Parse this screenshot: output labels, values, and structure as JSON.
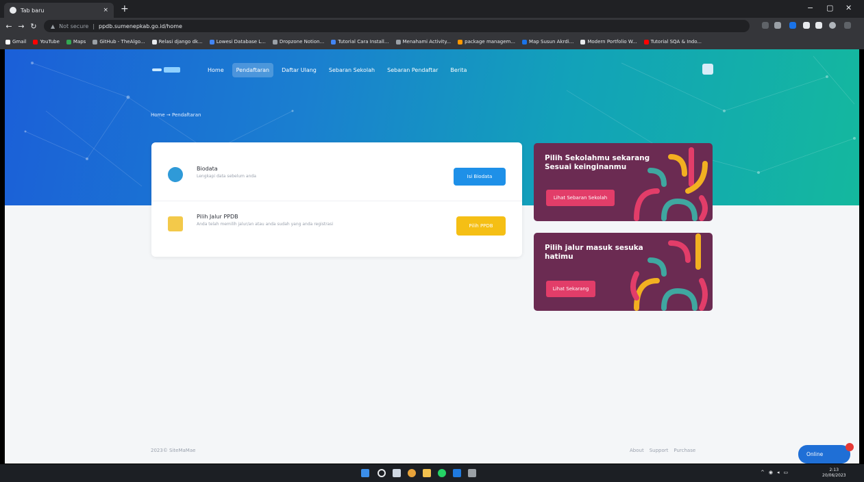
{
  "browser": {
    "tab_title": "Tab baru",
    "tab_close": "×",
    "new_tab": "+",
    "win_min": "−",
    "win_max": "▢",
    "win_close": "✕",
    "url_security": "Not secure",
    "url": "ppdb.sumenepkab.go.id/home",
    "bookmarks": [
      "Gmail",
      "YouTube",
      "Maps",
      "GitHub - TheAlgo...",
      "Relasi django dk...",
      "Lowesi Database L...",
      "Dropzone Notion...",
      "Tutorial Cara Install...",
      "Menahami Activity...",
      "package managem...",
      "Map Susun Akrdi...",
      "Modern Portfolio W...",
      "Tutorial SQA & Indo..."
    ],
    "bookmark_colors": [
      "#ffffff",
      "#ff0000",
      "#34a853",
      "#9aa0a6",
      "#e8eaed",
      "#4285f4",
      "#9aa0a6",
      "#4285f4",
      "#9aa0a6",
      "#ff9800",
      "#1a73e8",
      "#e8eaed",
      "#ff0000"
    ]
  },
  "nav": {
    "items": [
      "Home",
      "Pendaftaran",
      "Daftar Ulang",
      "Sebaran Sekolah",
      "Sebaran Pendaftar",
      "Berita"
    ],
    "active_index": 1
  },
  "breadcrumb": "Home → Pendaftaran",
  "card": {
    "row1": {
      "title": "Biodata",
      "subtitle": "Lengkapi data sebelum anda",
      "button": "Isi Biodata",
      "button_color": "#1e90e8",
      "icon_color": "#2f9ad8"
    },
    "row2": {
      "title": "Pilih Jalur PPDB",
      "subtitle": "Anda telah memilih jalur/an atau anda sudah yang anda registrasi",
      "button": "Pilih PPDB",
      "button_color": "#f5bf15",
      "icon_color": "#f3c94a"
    }
  },
  "promo1": {
    "title": "Pilih Sekolahmu sekarang Sesuai keinginanmu",
    "button": "Lihat Sebaran Sekolah"
  },
  "promo2": {
    "title": "Pilih jalur masuk sesuka hatimu",
    "button": "Lihat Sekarang"
  },
  "footer": {
    "left": "2023© SiteMaMae",
    "links": [
      "About",
      "Support",
      "Purchase"
    ]
  },
  "chat": {
    "label": "Online"
  },
  "taskbar": {
    "clock_time": "2:13",
    "clock_date": "20/06/2023"
  }
}
